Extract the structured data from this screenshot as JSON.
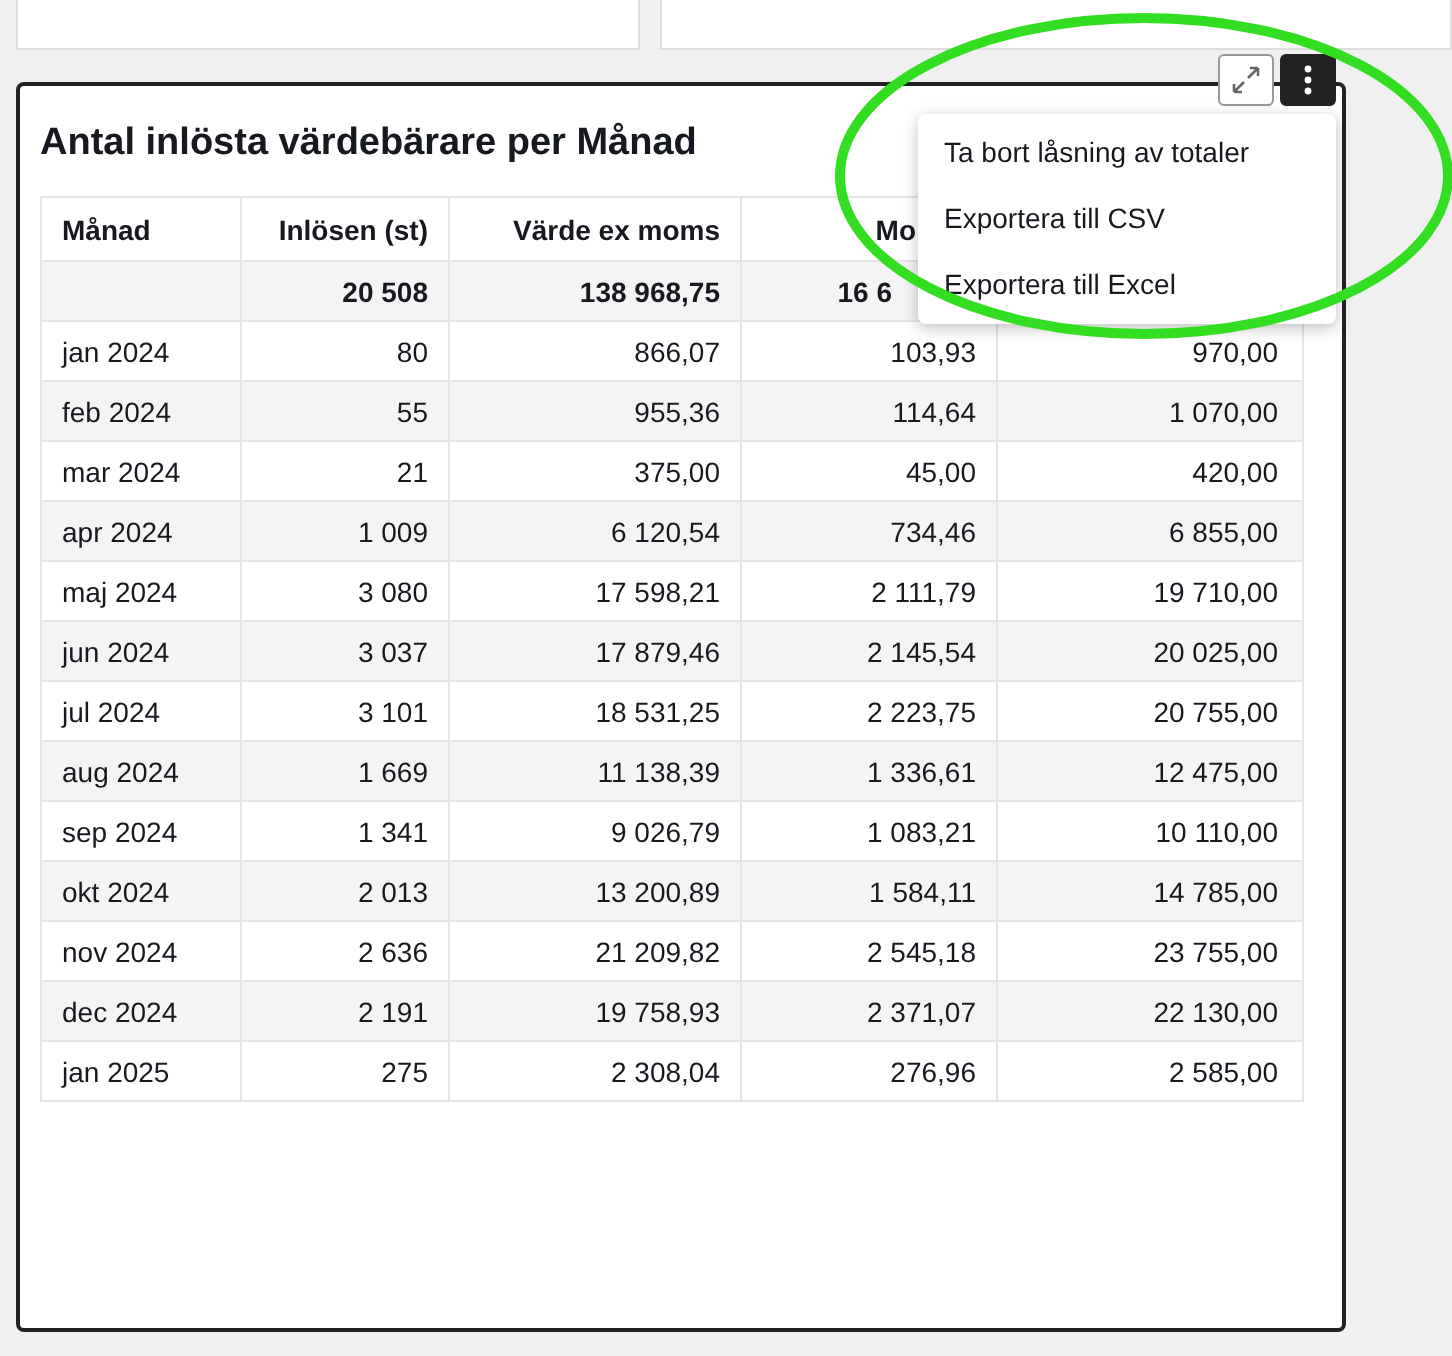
{
  "card": {
    "title": "Antal inlösta värdebärare per Månad"
  },
  "table": {
    "columns": [
      {
        "label": "Månad"
      },
      {
        "label": "Inlösen (st)",
        "total": "20 508"
      },
      {
        "label": "Värde ex moms",
        "total": "138 968,75"
      },
      {
        "label": "Mo",
        "total": "16 6",
        "cut": true
      },
      {}
    ],
    "rows": [
      [
        "jan 2024",
        "80",
        "866,07",
        "103,93",
        "970,00"
      ],
      [
        "feb 2024",
        "55",
        "955,36",
        "114,64",
        "1 070,00"
      ],
      [
        "mar 2024",
        "21",
        "375,00",
        "45,00",
        "420,00"
      ],
      [
        "apr 2024",
        "1 009",
        "6 120,54",
        "734,46",
        "6 855,00"
      ],
      [
        "maj 2024",
        "3 080",
        "17 598,21",
        "2 111,79",
        "19 710,00"
      ],
      [
        "jun 2024",
        "3 037",
        "17 879,46",
        "2 145,54",
        "20 025,00"
      ],
      [
        "jul 2024",
        "3 101",
        "18 531,25",
        "2 223,75",
        "20 755,00"
      ],
      [
        "aug 2024",
        "1 669",
        "11 138,39",
        "1 336,61",
        "12 475,00"
      ],
      [
        "sep 2024",
        "1 341",
        "9 026,79",
        "1 083,21",
        "10 110,00"
      ],
      [
        "okt 2024",
        "2 013",
        "13 200,89",
        "1 584,11",
        "14 785,00"
      ],
      [
        "nov 2024",
        "2 636",
        "21 209,82",
        "2 545,18",
        "23 755,00"
      ],
      [
        "dec 2024",
        "2 191",
        "19 758,93",
        "2 371,07",
        "22 130,00"
      ],
      [
        "jan 2025",
        "275",
        "2 308,04",
        "276,96",
        "2 585,00"
      ]
    ]
  },
  "menu": {
    "items": [
      "Ta bort låsning av totaler",
      "Exportera till CSV",
      "Exportera till Excel"
    ]
  }
}
